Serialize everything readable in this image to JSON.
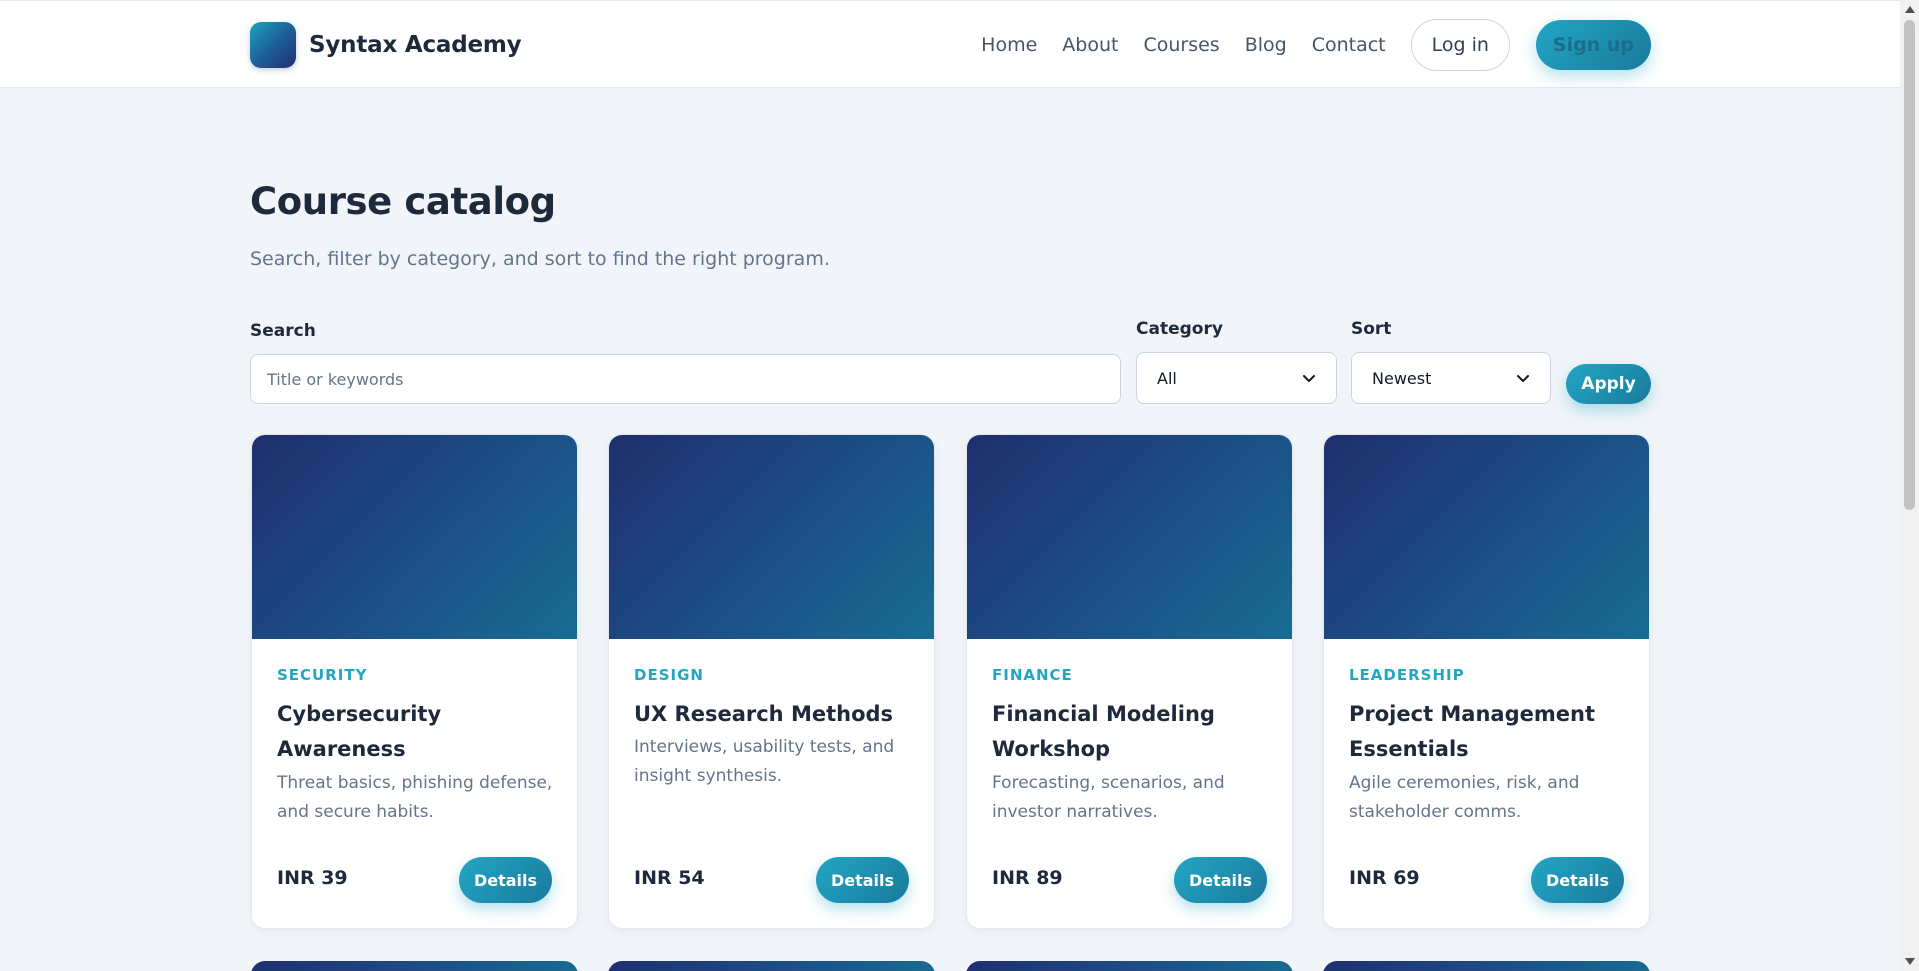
{
  "header": {
    "brand_name": "Syntax Academy",
    "nav": [
      "Home",
      "About",
      "Courses",
      "Blog",
      "Contact"
    ],
    "login_label": "Log in",
    "signup_label": "Sign up"
  },
  "main": {
    "title": "Course catalog",
    "subtitle": "Search, filter by category, and sort to find the right program."
  },
  "filters": {
    "search_label": "Search",
    "search_placeholder": "Title or keywords",
    "category_label": "Category",
    "category_value": "All",
    "sort_label": "Sort",
    "sort_value": "Newest",
    "apply_label": "Apply"
  },
  "courses": [
    {
      "category": "SECURITY",
      "title": "Cybersecurity Awareness",
      "description": "Threat basics, phishing defense, and secure habits.",
      "price": "INR 39",
      "details_label": "Details"
    },
    {
      "category": "DESIGN",
      "title": "UX Research Methods",
      "description": "Interviews, usability tests, and insight synthesis.",
      "price": "INR 54",
      "details_label": "Details"
    },
    {
      "category": "FINANCE",
      "title": "Financial Modeling Workshop",
      "description": "Forecasting, scenarios, and investor narratives.",
      "price": "INR 89",
      "details_label": "Details"
    },
    {
      "category": "LEADERSHIP",
      "title": "Project Management Essentials",
      "description": "Agile ceremonies, risk, and stakeholder comms.",
      "price": "INR 69",
      "details_label": "Details"
    }
  ],
  "colors": {
    "accent": "#22a6c4",
    "thumb_dark": "#1f2f6e",
    "thumb_light": "#176d93",
    "background": "#f1f5f9"
  }
}
